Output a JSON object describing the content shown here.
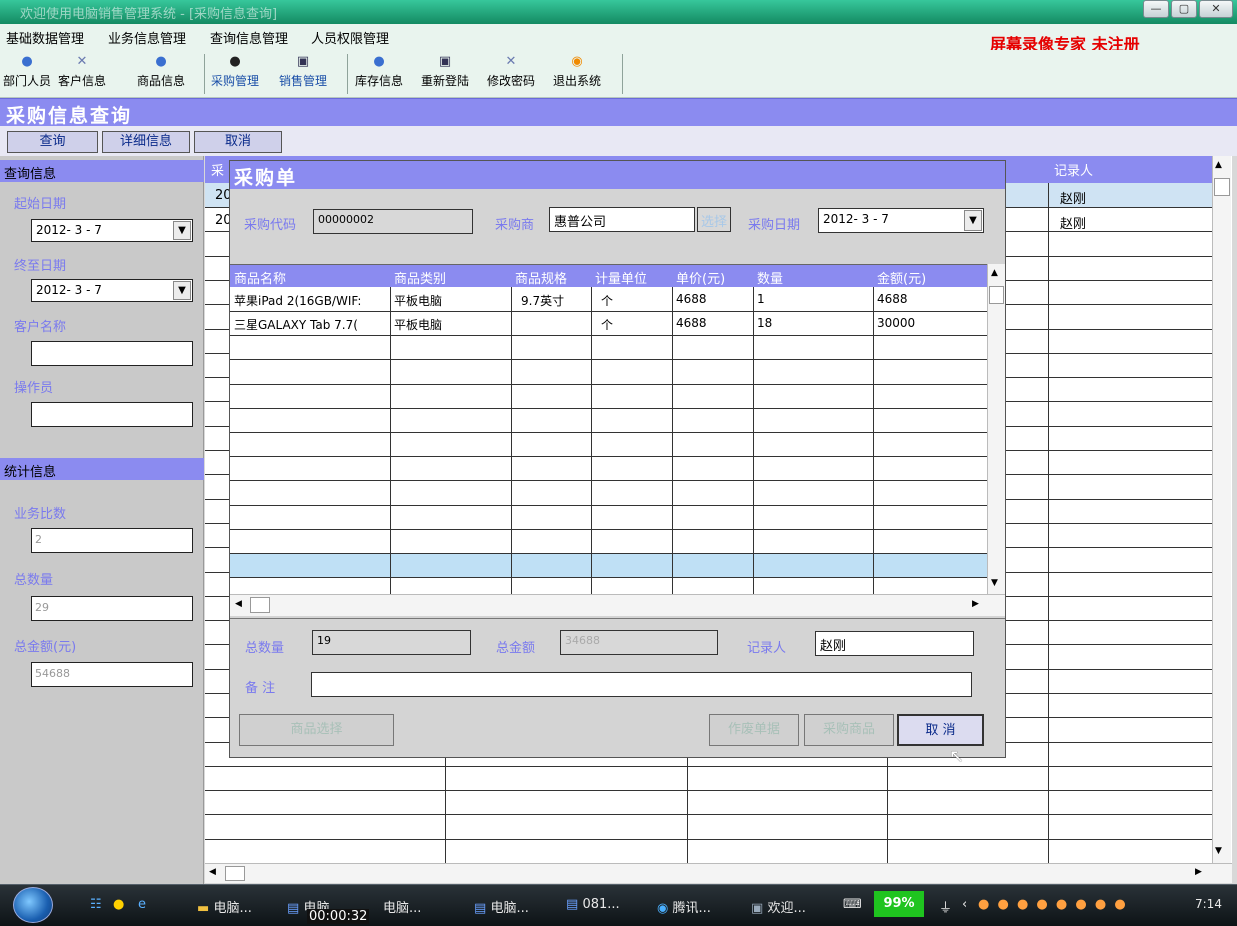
{
  "window": {
    "title": "欢迎使用电脑销售管理系统 - [采购信息查询]",
    "min": "—",
    "max": "▢",
    "close": "✕"
  },
  "menu": [
    "基础数据管理",
    "业务信息管理",
    "查询信息管理",
    "人员权限管理"
  ],
  "watermark": "屏幕录像专家 未注册",
  "toolbar": [
    "部门人员",
    "客户信息",
    "商品信息",
    "采购管理",
    "销售管理",
    "库存信息",
    "重新登陆",
    "修改密码",
    "退出系统"
  ],
  "page_title": "采购信息查询",
  "buttons": {
    "query": "查询",
    "detail": "详细信息",
    "cancel": "取消"
  },
  "left": {
    "query_header": "查询信息",
    "start_label": "起始日期",
    "start_value": "2012- 3 - 7",
    "end_label": "终至日期",
    "end_value": "2012- 3 - 7",
    "customer_label": "客户名称",
    "customer_value": "",
    "operator_label": "操作员",
    "operator_value": "",
    "stats_header": "统计信息",
    "count_label": "业务比数",
    "count_value": "2",
    "qty_label": "总数量",
    "qty_value": "29",
    "amount_label": "总金额(元)",
    "amount_value": "54688"
  },
  "grid": {
    "header_first": "采",
    "header_recorder": "记录人",
    "row1_first": "20",
    "row1_recorder": "赵刚",
    "row2_first": "20",
    "row2_recorder": "赵刚"
  },
  "dialog": {
    "title": "采购单",
    "code_label": "采购代码",
    "code_value": "00000002",
    "supplier_label": "采购商",
    "supplier_value": "惠普公司",
    "select_btn": "选择",
    "date_label": "采购日期",
    "date_value": "2012- 3 - 7",
    "columns": [
      "商品名称",
      "商品类别",
      "商品规格",
      "计量单位",
      "单价(元)",
      "数量",
      "金额(元)"
    ],
    "rows": [
      [
        "苹果iPad 2(16GB/WIF:",
        "平板电脑",
        "9.7英寸",
        "个",
        "4688",
        "1",
        "4688"
      ],
      [
        "三星GALAXY Tab 7.7(",
        "平板电脑",
        "",
        "个",
        "4688",
        "18",
        "30000"
      ]
    ],
    "total_qty_label": "总数量",
    "total_qty_value": "19",
    "total_amount_label": "总金额",
    "total_amount_value": "34688",
    "recorder_label": "记录人",
    "recorder_value": "赵刚",
    "remark_label": "备  注",
    "remark_value": "",
    "btn_select_goods": "商品选择",
    "btn_void": "作废单据",
    "btn_purchase": "采购商品",
    "btn_cancel": "取  消"
  },
  "taskbar": {
    "items": [
      "电脑...",
      "电脑",
      "电脑...",
      "电脑...",
      "081...",
      "腾讯...",
      "欢迎..."
    ],
    "timer": "00:00:32",
    "battery": "99%",
    "clock": "7:14"
  }
}
